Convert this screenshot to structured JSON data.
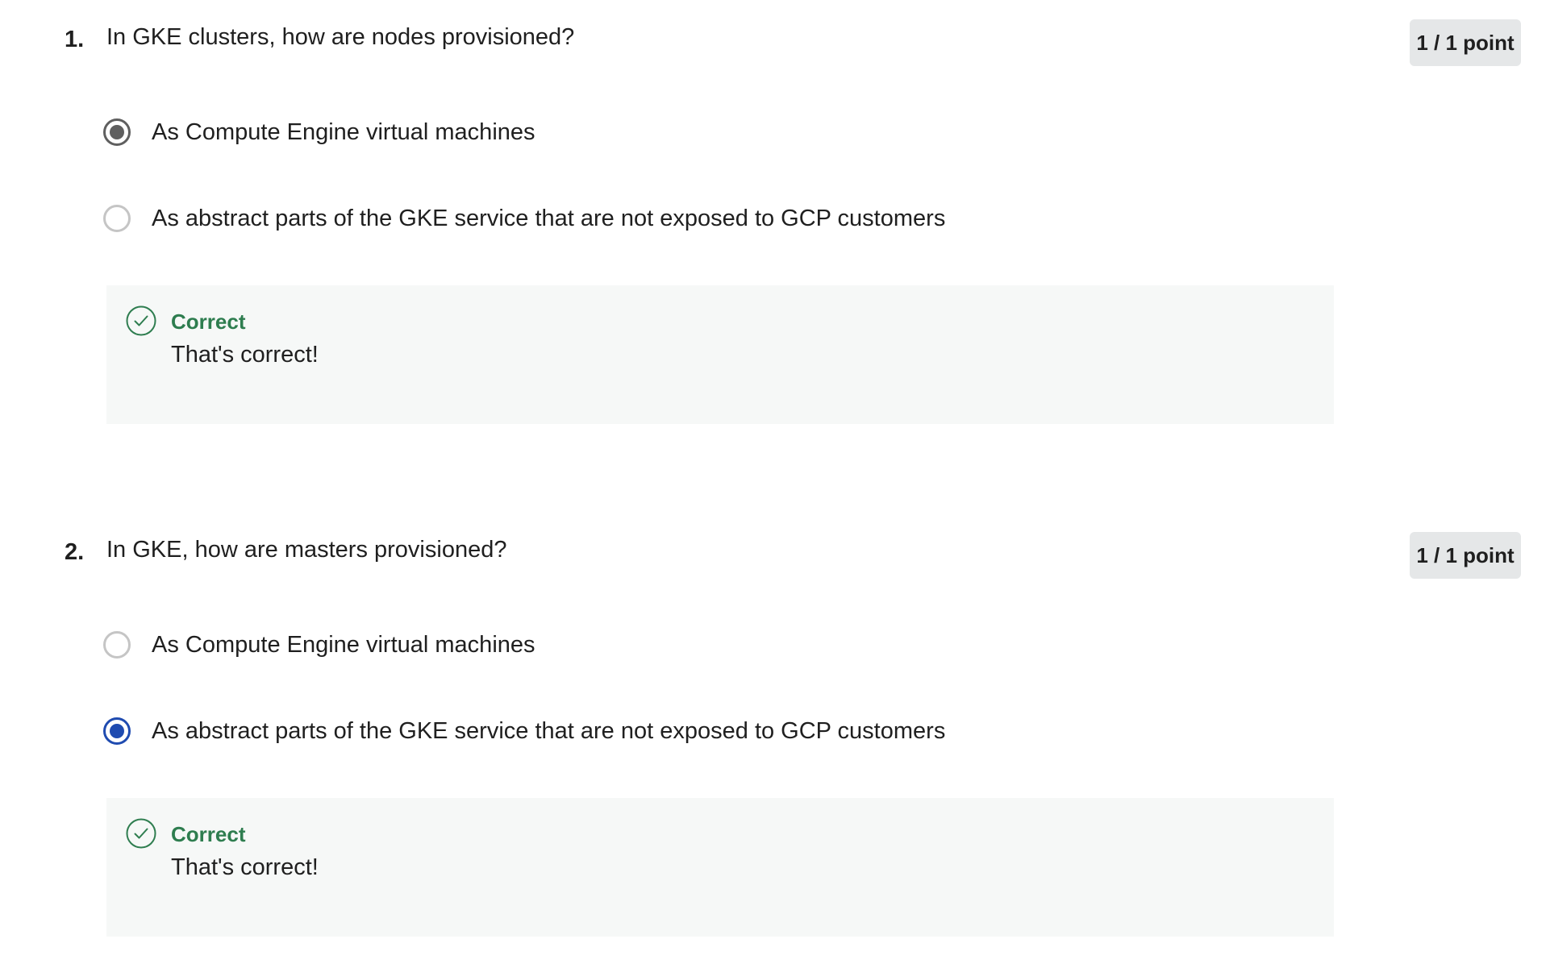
{
  "questions": [
    {
      "number": "1.",
      "text": "In GKE clusters, how are nodes provisioned?",
      "points": "1 / 1 point",
      "options": [
        {
          "label": "As Compute Engine virtual machines",
          "selected": true
        },
        {
          "label": "As abstract parts of the GKE service that are not exposed to GCP customers",
          "selected": false
        }
      ],
      "feedback": {
        "title": "Correct",
        "text": "That's correct!",
        "icon": "check-circle-icon"
      }
    },
    {
      "number": "2.",
      "text": "In GKE, how are masters provisioned?",
      "points": "1 / 1 point",
      "options": [
        {
          "label": "As Compute Engine virtual machines",
          "selected": false
        },
        {
          "label": "As abstract parts of the GKE service that are not exposed to GCP customers",
          "selected": true
        }
      ],
      "feedback": {
        "title": "Correct",
        "text": "That's correct!",
        "icon": "check-circle-icon"
      }
    }
  ],
  "colors": {
    "correct_green": "#2e7d4f",
    "selected_blue": "#1f4bb0",
    "selected_grey": "#5f5f5f",
    "badge_bg": "#e5e7e8",
    "feedback_bg": "#f6f8f7"
  }
}
